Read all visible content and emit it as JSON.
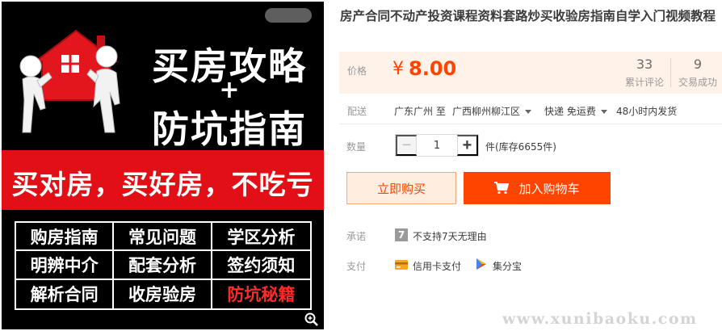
{
  "product_image": {
    "headline_line1": "买房攻略",
    "headline_plus": "+",
    "headline_line2": "防坑指南",
    "red_band_text": "买对房，买好房，不吃亏",
    "grid_items": [
      "购房指南",
      "常见问题",
      "学区分析",
      "明辨中介",
      "配套分析",
      "签约须知",
      "解析合同",
      "收房验房",
      "防坑秘籍"
    ],
    "highlight_color": "#ff2a2a",
    "zoom_icon": "magnifier-icon"
  },
  "product": {
    "title": "房产合同不动产投资课程资料套路炒买收验房指南自学入门视频教程"
  },
  "price_panel": {
    "label": "价格",
    "currency": "¥",
    "price": "8.00",
    "reviews_count": "33",
    "reviews_label": "累计评论",
    "sales_count": "9",
    "sales_label": "交易成功",
    "price_color": "#ff4400"
  },
  "delivery": {
    "label": "配送",
    "origin": "广东广州 至",
    "destination": "广西柳州柳江区",
    "method": "快递 免运费",
    "dispatch": "48小时内发货"
  },
  "quantity": {
    "label": "数量",
    "minus": "−",
    "value": "1",
    "plus": "+",
    "stock": "件(库存6655件)"
  },
  "actions": {
    "buy_now": "立即购买",
    "add_to_cart": "加入购物车",
    "accent_color": "#ff4400"
  },
  "promise": {
    "label": "承诺",
    "icon_text": "7",
    "text": "不支持7天无理由"
  },
  "payment": {
    "label": "支付",
    "credit_card": "信用卡支付",
    "jifenbao": "集分宝"
  },
  "watermark": "www.xunibaoku.com"
}
